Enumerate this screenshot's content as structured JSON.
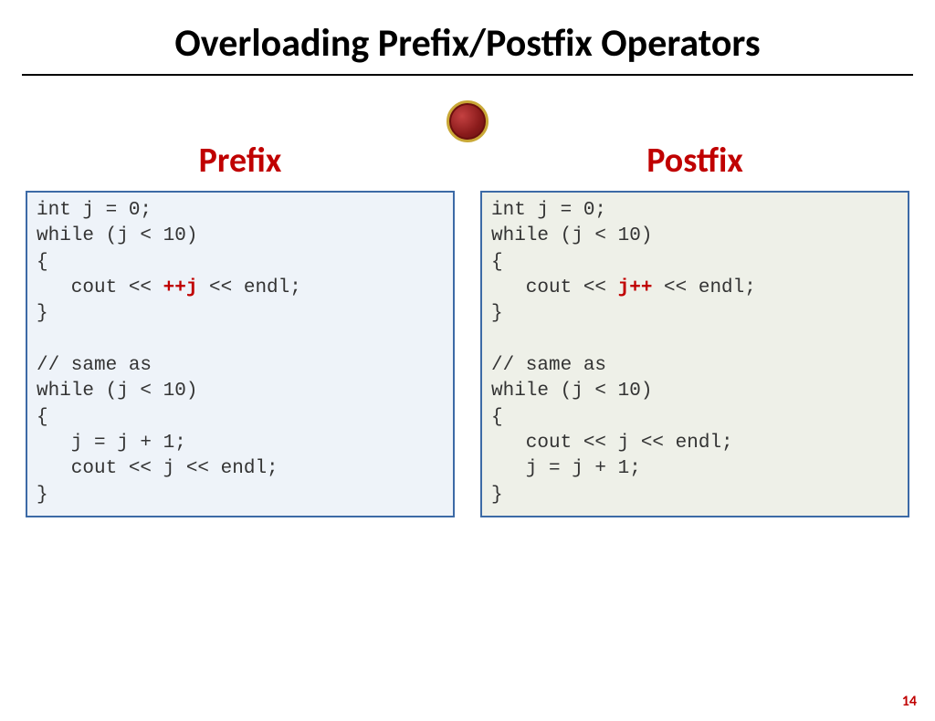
{
  "title": "Overloading Prefix/Postfix Operators",
  "page_number": "14",
  "prefix_heading": "Prefix",
  "postfix_heading": "Postfix",
  "prefix": {
    "l1": "int j = 0;",
    "l2": "while (j < 10)",
    "l3": "{",
    "l4a": "   cout << ",
    "l4hl": "++j",
    "l4b": " << endl;",
    "l5": "}",
    "l6": "",
    "l7": "// same as",
    "l8": "while (j < 10)",
    "l9": "{",
    "l10": "   j = j + 1;",
    "l11": "   cout << j << endl;",
    "l12": "}"
  },
  "postfix": {
    "l1": "int j = 0;",
    "l2": "while (j < 10)",
    "l3": "{",
    "l4a": "   cout << ",
    "l4hl": "j++",
    "l4b": " << endl;",
    "l5": "}",
    "l6": "",
    "l7": "// same as",
    "l8": "while (j < 10)",
    "l9": "{",
    "l10": "   cout << j << endl;",
    "l11": "   j = j + 1;",
    "l12": "}"
  }
}
